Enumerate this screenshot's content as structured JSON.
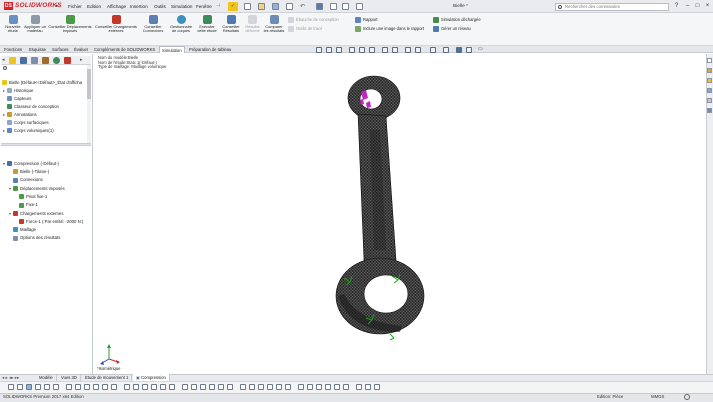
{
  "app": {
    "logo_text": "SOLIDWORKS",
    "logo_mark": "DS",
    "document_title": "Bielle *"
  },
  "menu": [
    "Fichier",
    "Edition",
    "Affichage",
    "Insertion",
    "Outils",
    "Simulation",
    "Fenêtre"
  ],
  "search": {
    "placeholder": "Rechercher des commandes"
  },
  "ribbon": {
    "buttons": [
      {
        "label": "Nouvelle étude",
        "icon": "new-study-icon",
        "color": "#6b8fc5"
      },
      {
        "label": "Appliquer un matériau",
        "icon": "apply-material-icon",
        "color": "#8e9aa8"
      },
      {
        "label": "Conseiller Déplacements imposés",
        "icon": "fixtures-advisor-icon",
        "color": "#4a9a46"
      },
      {
        "label": "Conseiller Chargements externes",
        "icon": "external-loads-advisor-icon",
        "color": "#c0392b"
      },
      {
        "label": "Conseiller Connexions",
        "icon": "connections-advisor-icon",
        "color": "#5a7fb5"
      },
      {
        "label": "Gestionnaire de coques",
        "icon": "shell-manager-icon",
        "color": "#3d8fbf"
      },
      {
        "label": "Exécuter cette étude",
        "icon": "run-study-icon",
        "color": "#3b8c5a"
      },
      {
        "label": "Conseiller Résultats",
        "icon": "results-advisor-icon",
        "color": "#4f79b1"
      },
      {
        "label": "Résultat déformé",
        "icon": "deformed-result-icon",
        "color": "#b9bfc7"
      },
      {
        "label": "Comparer les résultats",
        "icon": "compare-results-icon",
        "color": "#6e8db5"
      }
    ],
    "small_disabled": [
      "Ébauche de conception",
      "Outils de tracé"
    ],
    "small_right": [
      "Rapport",
      "Inclure une image dans le rapport",
      "Simulation déchargée",
      "Gérer un réseau"
    ]
  },
  "tabs": [
    {
      "label": "Fonctions",
      "active": false
    },
    {
      "label": "Esquisse",
      "active": false
    },
    {
      "label": "Surfaces",
      "active": false
    },
    {
      "label": "Évaluer",
      "active": false
    },
    {
      "label": "Compléments de SOLIDWORKS",
      "active": false
    },
    {
      "label": "Simulation",
      "active": true
    },
    {
      "label": "Préparation de tableau",
      "active": false
    }
  ],
  "feature_tree": {
    "root": "Bielle (Défaut<<Défaut>_État d'afficha",
    "items": [
      "Historique",
      "Capteurs",
      "Classeur de conception",
      "Annotations",
      "Corps surfaciques",
      "Corps volumiques(1)"
    ]
  },
  "simulation_tree": {
    "study": "Compression (-Défaut-)",
    "items": [
      {
        "label": "Bielle (-Titane-)",
        "indent": 1,
        "icon": "part-icon"
      },
      {
        "label": "Connexions",
        "indent": 1,
        "icon": "connections-icon"
      },
      {
        "label": "Déplacements imposés",
        "indent": 1,
        "icon": "fixtures-icon"
      },
      {
        "label": "Pivot fixe-1",
        "indent": 2,
        "icon": "pivot-fixture-icon"
      },
      {
        "label": "Fixe-1",
        "indent": 2,
        "icon": "fixed-fixture-icon"
      },
      {
        "label": "Chargements externes",
        "indent": 1,
        "icon": "external-loads-icon"
      },
      {
        "label": "Force-1 (:Par entité: -2000 N:)",
        "indent": 2,
        "icon": "force-icon"
      },
      {
        "label": "Maillage",
        "indent": 1,
        "icon": "mesh-icon"
      },
      {
        "label": "Options des résultats",
        "indent": 1,
        "icon": "result-options-icon"
      }
    ]
  },
  "viewport": {
    "info_lines": [
      "Nom du modèle:Bielle",
      "Nom de l'étude:Statc 1(-Défaut-)",
      "Type de maillage: Maillage volumique"
    ],
    "view_name": "*Isométrique"
  },
  "bottom_tabs": [
    {
      "label": "Modèle",
      "active": false
    },
    {
      "label": "Vues 3D",
      "active": false
    },
    {
      "label": "Etude de mouvement 1",
      "active": false
    },
    {
      "label": "Compression",
      "active": true
    }
  ],
  "status": {
    "left": "SOLIDWORKS Premium 2017 x64 Edition",
    "mode": "Edition: Pièce",
    "units": "MMGS"
  },
  "colors": {
    "accent": "#d4262b",
    "mesh": "#1a1a1a",
    "fixture": "#1aa31a",
    "load": "#c026c0"
  }
}
